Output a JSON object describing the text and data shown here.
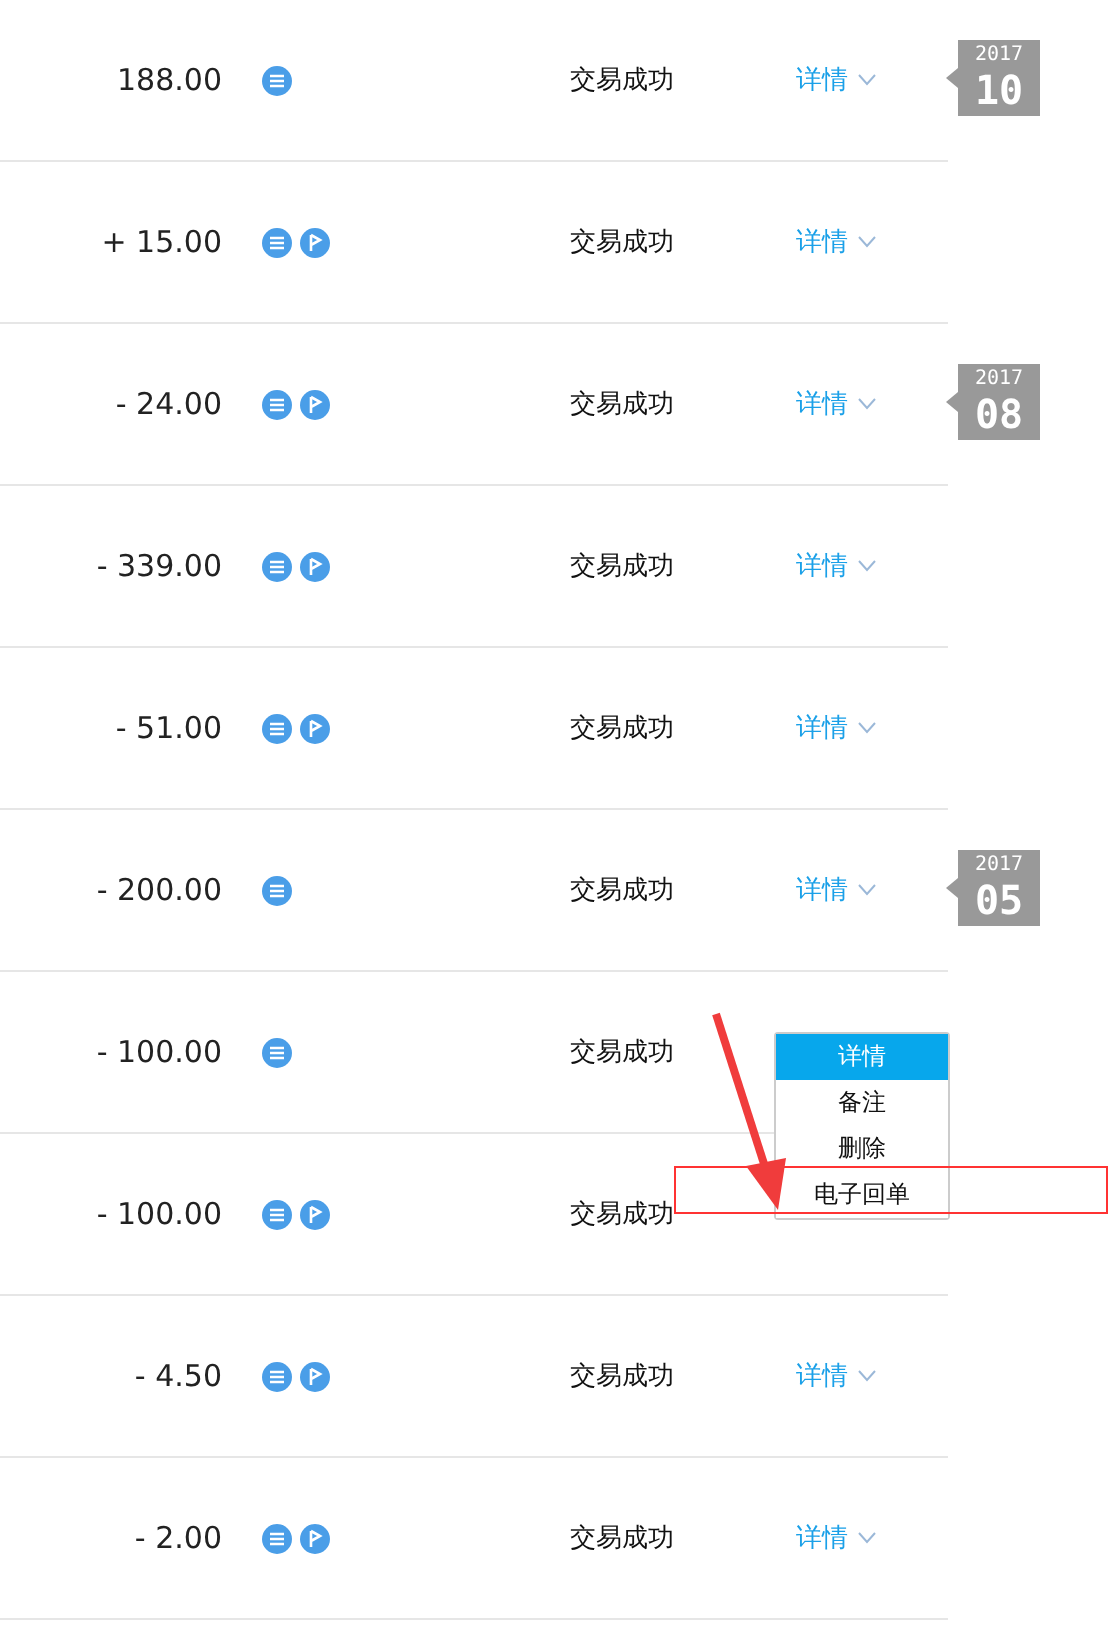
{
  "rows": [
    {
      "amount": "188.00",
      "icons": [
        {
          "kind": "list"
        }
      ],
      "status": "交易成功",
      "details": "详情",
      "date_tag": {
        "year": "2017",
        "month": "10"
      }
    },
    {
      "amount": "+ 15.00",
      "icons": [
        {
          "kind": "list"
        },
        {
          "kind": "flag"
        }
      ],
      "status": "交易成功",
      "details": "详情"
    },
    {
      "amount": "- 24.00",
      "icons": [
        {
          "kind": "list"
        },
        {
          "kind": "flag"
        }
      ],
      "status": "交易成功",
      "details": "详情",
      "date_tag": {
        "year": "2017",
        "month": "08"
      }
    },
    {
      "amount": "- 339.00",
      "icons": [
        {
          "kind": "list"
        },
        {
          "kind": "flag"
        }
      ],
      "status": "交易成功",
      "details": "详情"
    },
    {
      "amount": "- 51.00",
      "icons": [
        {
          "kind": "list"
        },
        {
          "kind": "flag"
        }
      ],
      "status": "交易成功",
      "details": "详情"
    },
    {
      "amount": "- 200.00",
      "icons": [
        {
          "kind": "list"
        }
      ],
      "status": "交易成功",
      "details": "详情",
      "date_tag": {
        "year": "2017",
        "month": "05"
      }
    },
    {
      "amount": "- 100.00",
      "icons": [
        {
          "kind": "list"
        }
      ],
      "status": "交易成功"
    },
    {
      "amount": "- 100.00",
      "icons": [
        {
          "kind": "list"
        },
        {
          "kind": "flag"
        }
      ],
      "status": "交易成功"
    },
    {
      "amount": "- 4.50",
      "icons": [
        {
          "kind": "list"
        },
        {
          "kind": "flag"
        }
      ],
      "status": "交易成功",
      "details": "详情"
    },
    {
      "amount": "- 2.00",
      "icons": [
        {
          "kind": "list"
        },
        {
          "kind": "flag"
        }
      ],
      "status": "交易成功",
      "details": "详情"
    }
  ],
  "menu": {
    "items": [
      {
        "label": "详情",
        "selected": true
      },
      {
        "label": "备注",
        "selected": false
      },
      {
        "label": "删除",
        "selected": false
      },
      {
        "label": "电子回单",
        "selected": false
      }
    ]
  }
}
